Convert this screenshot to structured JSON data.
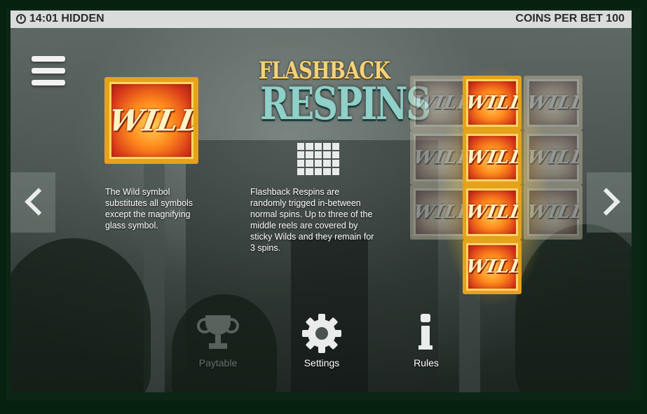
{
  "status_bar": {
    "time": "14:01",
    "player": "HIDDEN",
    "coins_per_bet": "COINS PER BET 100"
  },
  "icons": {
    "clock": "clock-icon",
    "menu": "hamburger-menu-icon",
    "prev": "chevron-left-icon",
    "next": "chevron-right-icon",
    "paytable": "trophy-icon",
    "settings": "gear-icon",
    "rules": "info-icon",
    "reels": "grid-icon"
  },
  "wild": {
    "symbol_text": "WILD",
    "description": "The Wild symbol substitutes all symbols except the magnifying glass symbol."
  },
  "feature": {
    "title_line1": "FLASHBACK",
    "title_line2": "RESPINS",
    "description": "Flashback Respins are randomly trigged in-between normal spins. Up to three of the middle reels are covered by sticky Wilds and they remain for 3 spins."
  },
  "nav": {
    "paytable": "Paytable",
    "settings": "Settings",
    "rules": "Rules"
  },
  "colors": {
    "gold": "#e5a21a",
    "wild_red": "#d6361a",
    "title_gold": "#f2d27a",
    "title_teal": "#8fd0c9"
  }
}
